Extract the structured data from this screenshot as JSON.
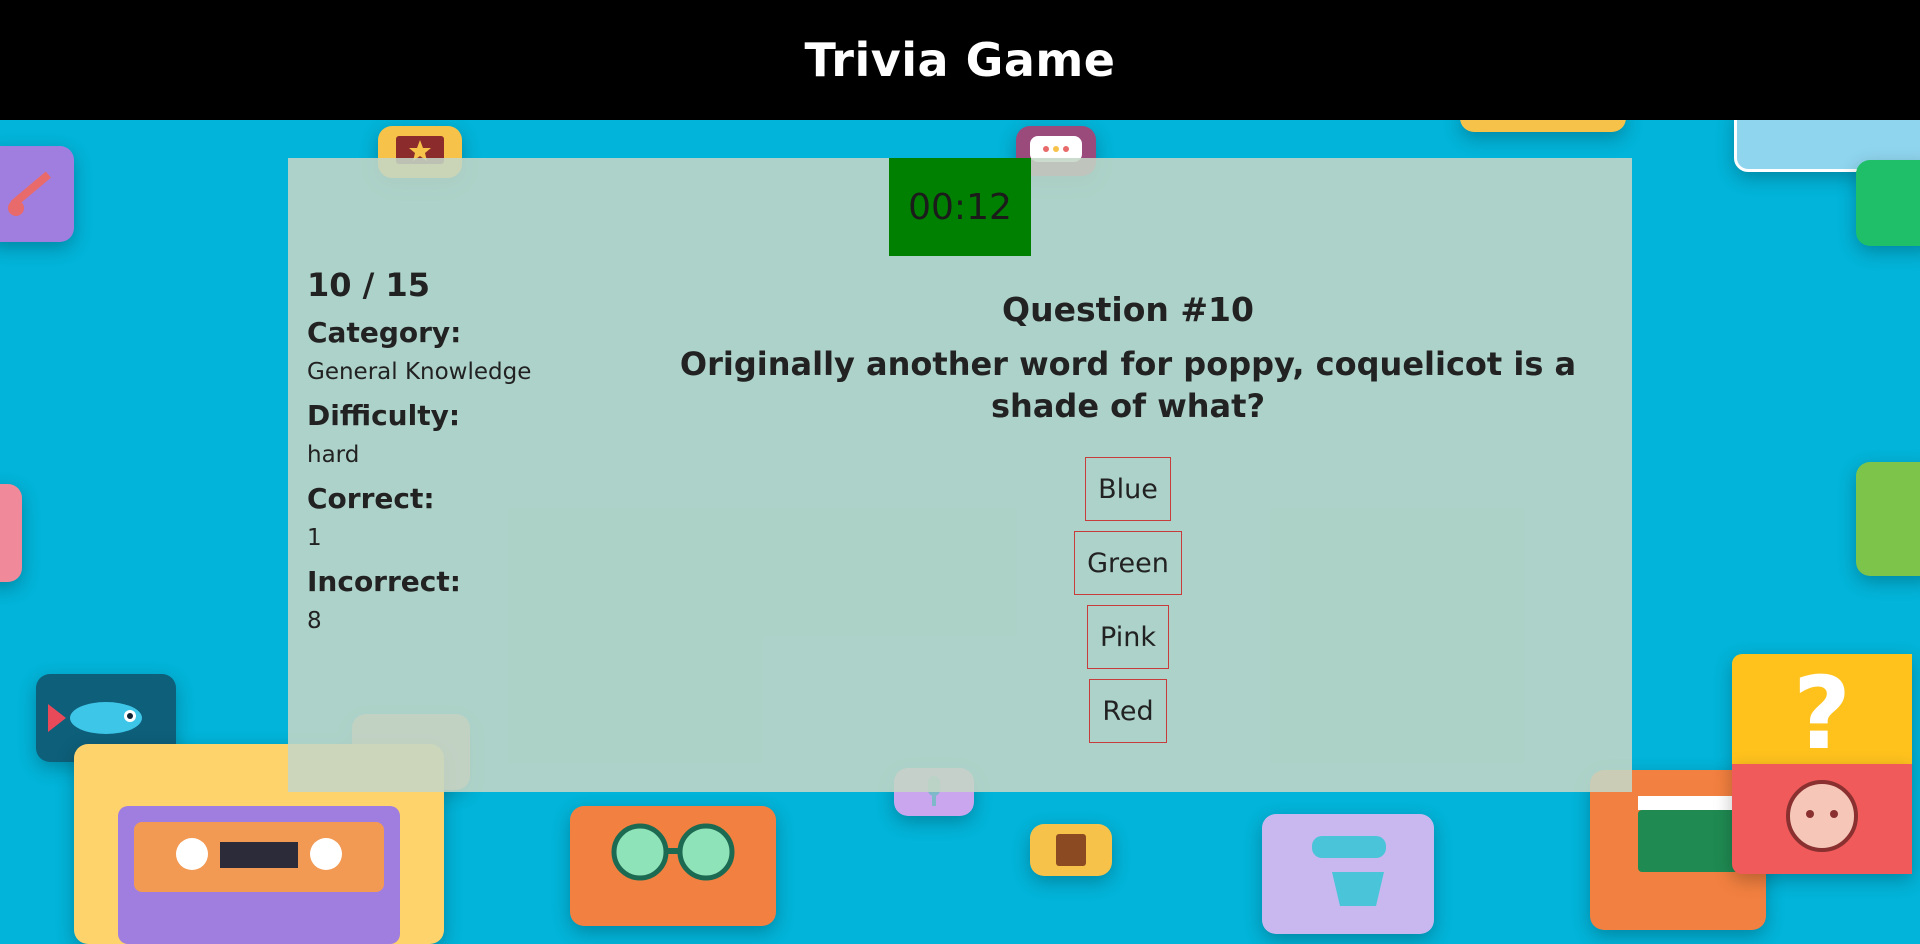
{
  "header": {
    "title": "Trivia Game"
  },
  "timer": {
    "value": "00:12"
  },
  "stats": {
    "progress": "10 / 15",
    "category_label": "Category:",
    "category_value": "General Knowledge",
    "difficulty_label": "Difficulty:",
    "difficulty_value": "hard",
    "correct_label": "Correct:",
    "correct_value": "1",
    "incorrect_label": "Incorrect:",
    "incorrect_value": "8"
  },
  "question": {
    "number": "Question #10",
    "text": "Originally another word for poppy, coquelicot is a shade of what?"
  },
  "answers": [
    "Blue",
    "Green",
    "Pink",
    "Red"
  ],
  "colors": {
    "background": "#02b4d9",
    "header": "#000000",
    "card": "#c4d6c6",
    "timer": "#008000",
    "answer_border": "#c83c3c"
  },
  "icons": [
    "guitar-icon",
    "star-ticket-icon",
    "chat-bubble-icon",
    "fish-icon",
    "cassette-tape-icon",
    "sunglasses-icon",
    "microphone-icon",
    "book-icon",
    "stand-mixer-icon",
    "clapperboard-icon",
    "question-mark-icon",
    "baby-face-icon"
  ]
}
